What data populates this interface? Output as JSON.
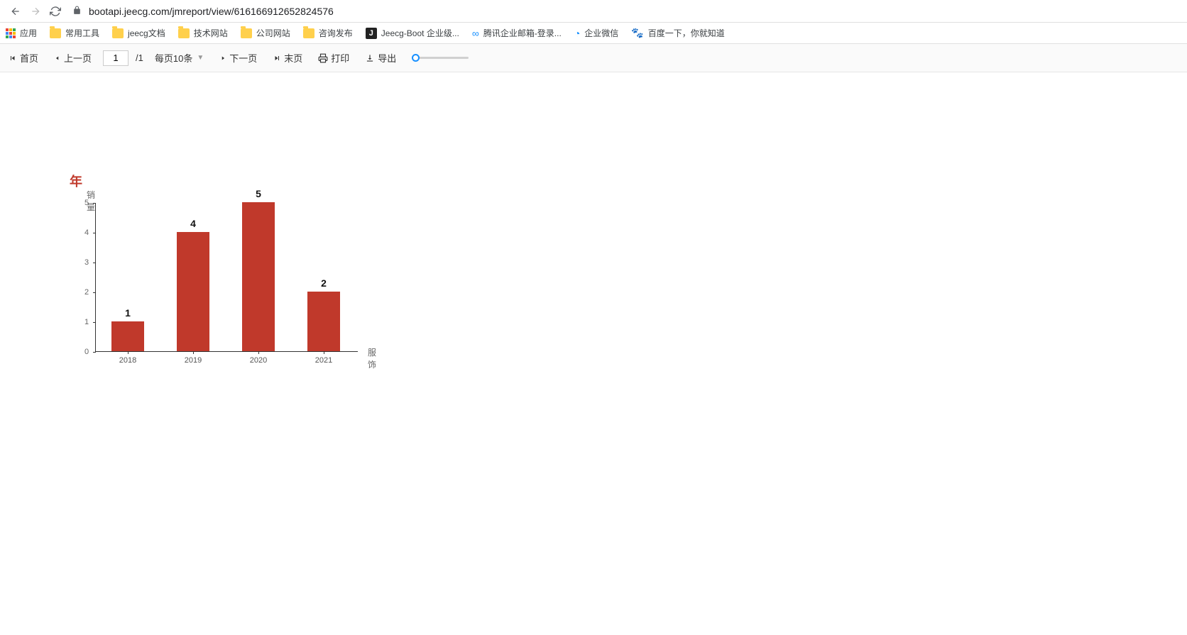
{
  "browser": {
    "url": "bootapi.jeecg.com/jmreport/view/616166912652824576"
  },
  "bookmarks": {
    "apps": "应用",
    "b1": "常用工具",
    "b2": "jeecg文档",
    "b3": "技术网站",
    "b4": "公司网站",
    "b5": "咨询发布",
    "b6": "Jeecg-Boot 企业级...",
    "b7": "腾讯企业邮箱-登录...",
    "b8": "企业微信",
    "b9": "百度一下，你就知道"
  },
  "toolbar": {
    "first": "首页",
    "prev": "上一页",
    "page_value": "1",
    "page_total": "/1",
    "per_page": "每页10条",
    "next": "下一页",
    "last": "末页",
    "print": "打印",
    "export": "导出"
  },
  "chart_data": {
    "type": "bar",
    "title": "年",
    "ylabel": "销量",
    "xlabel": "服饰",
    "categories": [
      "2018",
      "2019",
      "2020",
      "2021"
    ],
    "values": [
      1,
      4,
      5,
      2
    ],
    "ylim": [
      0,
      5
    ],
    "yticks": [
      0,
      1,
      2,
      3,
      4,
      5
    ],
    "bar_color": "#c0392b"
  }
}
